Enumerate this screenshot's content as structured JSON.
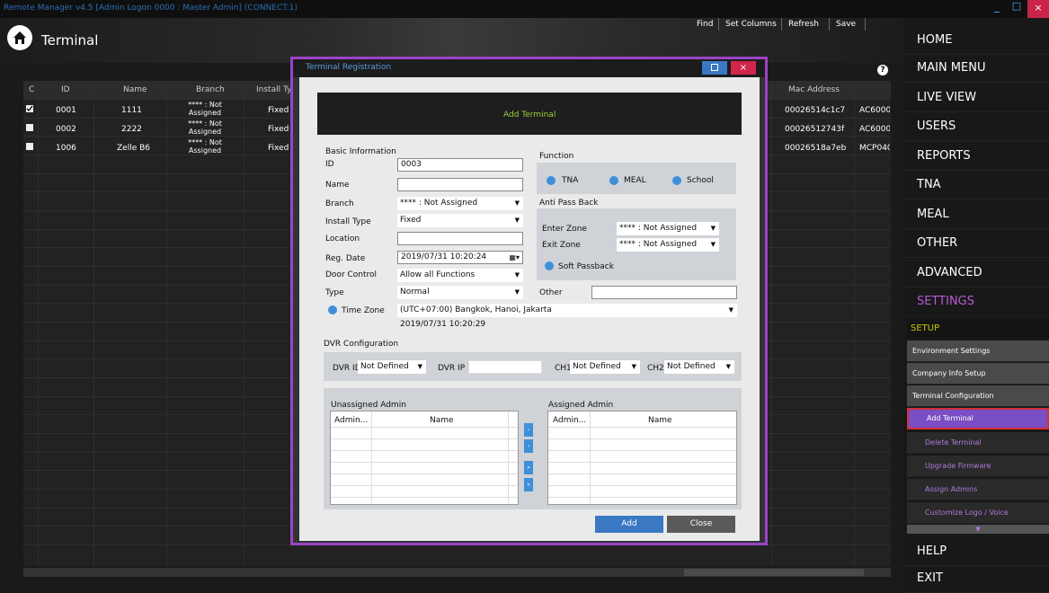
{
  "window": {
    "title": "Remote Manager v4.5 [Admin Logon 0000 : Master Admin] (CONNECT:1)",
    "minimize": "_",
    "maximize": "□",
    "close": "×"
  },
  "header": {
    "title": "Terminal",
    "toolbar": [
      "Find",
      "Set Columns",
      "Refresh",
      "Save"
    ]
  },
  "grid": {
    "columns": [
      "C",
      "ID",
      "Name",
      "Branch",
      "Install Typ",
      "Mac Address"
    ],
    "rows": [
      {
        "checked": true,
        "id": "0001",
        "name": "1111",
        "branch": "**** : Not Assigned",
        "install": "Fixed",
        "mac": "00026514c1c7",
        "extra": "AC6000"
      },
      {
        "checked": false,
        "id": "0002",
        "name": "2222",
        "branch": "**** : Not Assigned",
        "install": "Fixed",
        "mac": "00026512743f",
        "extra": "AC6000"
      },
      {
        "checked": false,
        "id": "1006",
        "name": "Zelle B6",
        "branch": "**** : Not Assigned",
        "install": "Fixed",
        "mac": "00026518a7eb",
        "extra": "MCP040"
      }
    ],
    "help": "?"
  },
  "sidebar": {
    "items": [
      "HOME",
      "MAIN MENU",
      "LIVE VIEW",
      "USERS",
      "REPORTS",
      "TNA",
      "MEAL",
      "OTHER",
      "ADVANCED",
      "SETTINGS"
    ],
    "active": "SETTINGS",
    "setup_label": "SETUP",
    "sub_items": [
      "Environment Settings",
      "Company Info Setup",
      "Terminal Configuration"
    ],
    "terminal_items": [
      "Add Terminal",
      "Delete Terminal",
      "Upgrade Firmware",
      "Assign Admins",
      "Customize Logo / Voice"
    ],
    "bottom": [
      "HELP",
      "EXIT"
    ]
  },
  "dialog": {
    "title": "Terminal Registration",
    "banner": "Add Terminal",
    "basic_info": "Basic Information",
    "fields": {
      "id_label": "ID",
      "id_value": "0003",
      "name_label": "Name",
      "name_value": "",
      "branch_label": "Branch",
      "branch_value": "**** : Not Assigned",
      "install_label": "Install Type",
      "install_value": "Fixed",
      "location_label": "Location",
      "location_value": "",
      "regdate_label": "Reg. Date",
      "regdate_value": "2019/07/31 10:20:24",
      "door_label": "Door Control",
      "door_value": "Allow all Functions",
      "type_label": "Type",
      "type_value": "Normal",
      "tz_label": "Time Zone",
      "tz_value": "(UTC+07:00) Bangkok, Hanoi, Jakarta",
      "tz_time": "2019/07/31 10:20:29"
    },
    "function": {
      "label": "Function",
      "options": [
        "TNA",
        "MEAL",
        "School"
      ]
    },
    "apb": {
      "label": "Anti Pass Back",
      "enter_label": "Enter Zone",
      "enter_value": "**** : Not Assigned",
      "exit_label": "Exit Zone",
      "exit_value": "**** : Not Assigned",
      "soft": "Soft Passback"
    },
    "other": {
      "label": "Other",
      "value": ""
    },
    "dvr": {
      "label": "DVR Configuration",
      "id_label": "DVR ID",
      "id_value": "Not Defined",
      "ip_label": "DVR IP",
      "ip_value": "",
      "ch1_label": "CH1",
      "ch1_value": "Not Defined",
      "ch2_label": "CH2",
      "ch2_value": "Not Defined"
    },
    "admins": {
      "unassigned": "Unassigned Admin",
      "assigned": "Assigned Admin",
      "col_admin": "Admin...",
      "col_name": "Name",
      "move_buttons": [
        "›",
        "‹",
        "»",
        "«"
      ]
    },
    "add": "Add",
    "close": "Close",
    "close_x": "×"
  }
}
